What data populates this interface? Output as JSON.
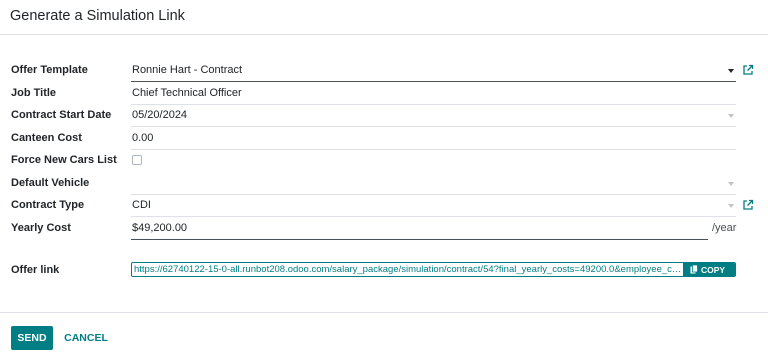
{
  "dialog": {
    "title": "Generate a Simulation Link"
  },
  "form": {
    "offer_template": {
      "label": "Offer Template",
      "value": "Ronnie Hart - Contract"
    },
    "job_title": {
      "label": "Job Title",
      "value": "Chief Technical Officer"
    },
    "contract_start_date": {
      "label": "Contract Start Date",
      "value": "05/20/2024"
    },
    "canteen_cost": {
      "label": "Canteen Cost",
      "value": "0.00"
    },
    "force_new_cars_list": {
      "label": "Force New Cars List",
      "checked": false
    },
    "default_vehicle": {
      "label": "Default Vehicle",
      "value": ""
    },
    "contract_type": {
      "label": "Contract Type",
      "value": "CDI"
    },
    "yearly_cost": {
      "label": "Yearly Cost",
      "value": "$49,200.00",
      "suffix": "/year"
    },
    "offer_link": {
      "label": "Offer link",
      "value": "https://62740122-15-0-all.runbot208.odoo.com/salary_package/simulation/contract/54?final_yearly_costs=49200.0&employee_co...",
      "copy_label": "COPY"
    }
  },
  "footer": {
    "send_label": "SEND",
    "cancel_label": "CANCEL"
  },
  "colors": {
    "accent": "#017e84",
    "border": "#dee2e6",
    "text": "#212529"
  },
  "icons": {
    "external_link": "external-link-icon",
    "dropdown": "chevron-down-icon",
    "copy": "clipboard-icon"
  }
}
